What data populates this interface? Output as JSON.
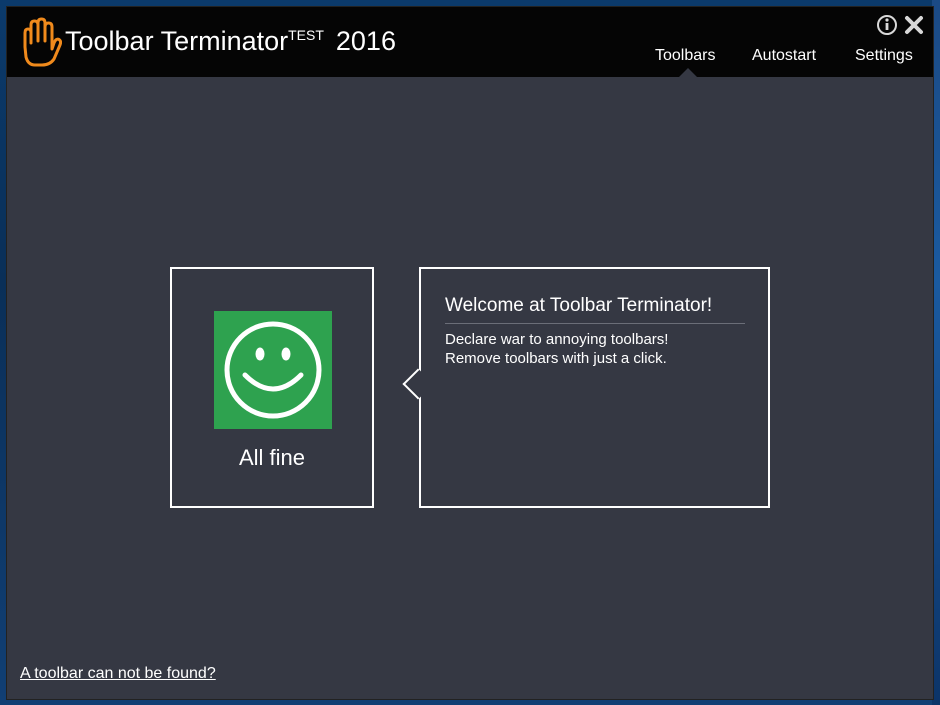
{
  "window": {
    "title": "Toolbar Terminator",
    "title_superscript": "TEST",
    "title_year": "2016",
    "logo_icon": "hand-stop-icon",
    "colors": {
      "titlebar": "#050505",
      "body": "#353843",
      "logo_orange": "#f08a1c",
      "status_green": "#2ea24f"
    }
  },
  "nav": {
    "items": [
      {
        "label": "Toolbars",
        "active": true
      },
      {
        "label": "Autostart",
        "active": false
      },
      {
        "label": "Settings",
        "active": false
      }
    ]
  },
  "window_controls": {
    "info_icon": "info-icon",
    "close_icon": "close-icon"
  },
  "status": {
    "icon": "smiley-icon",
    "label": "All fine"
  },
  "welcome": {
    "title": "Welcome at Toolbar Terminator!",
    "line1": "Declare war to annoying toolbars!",
    "line2": "Remove toolbars with just a click."
  },
  "footer": {
    "link_label": "A toolbar can not be found?"
  }
}
